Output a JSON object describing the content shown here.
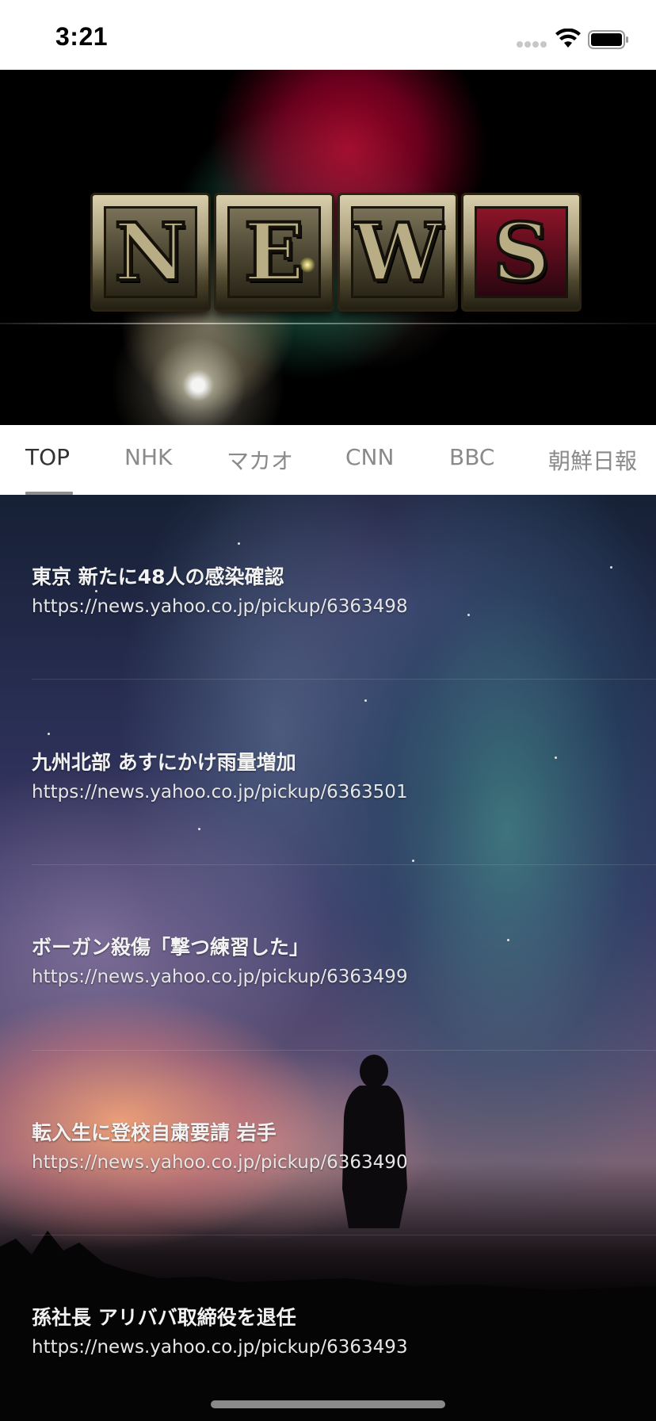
{
  "status_bar": {
    "time": "3:21"
  },
  "header": {
    "banner_letters": [
      "N",
      "E",
      "W",
      "S"
    ],
    "colors": {
      "tile_face": "#b9ad86",
      "s_tile_background": "#8c1428"
    }
  },
  "tabs": [
    {
      "label": "TOP",
      "active": true
    },
    {
      "label": "NHK",
      "active": false
    },
    {
      "label": "マカオ",
      "active": false
    },
    {
      "label": "CNN",
      "active": false
    },
    {
      "label": "BBC",
      "active": false
    },
    {
      "label": "朝鮮日報",
      "active": false
    }
  ],
  "news": [
    {
      "title": "東京 新たに48人の感染確認",
      "url": "https://news.yahoo.co.jp/pickup/6363498"
    },
    {
      "title": "九州北部 あすにかけ雨量増加",
      "url": "https://news.yahoo.co.jp/pickup/6363501"
    },
    {
      "title": "ボーガン殺傷「撃つ練習した」",
      "url": "https://news.yahoo.co.jp/pickup/6363499"
    },
    {
      "title": "転入生に登校自粛要請 岩手",
      "url": "https://news.yahoo.co.jp/pickup/6363490"
    },
    {
      "title": "孫社長 アリババ取締役を退任",
      "url": "https://news.yahoo.co.jp/pickup/6363493"
    }
  ]
}
